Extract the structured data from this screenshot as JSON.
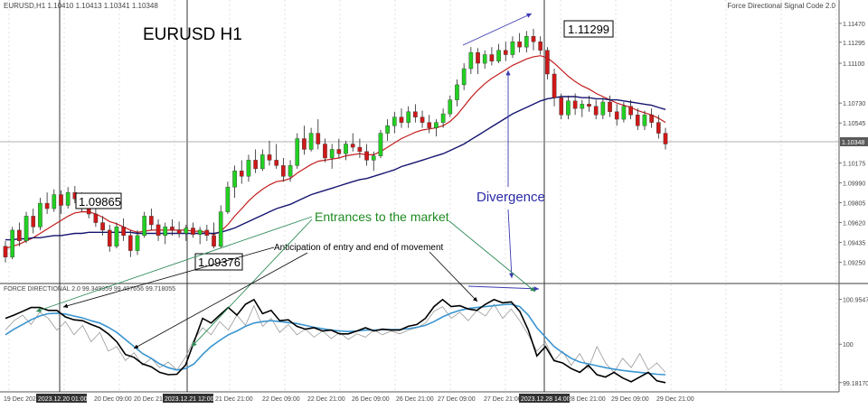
{
  "chart_data": [
    {
      "type": "candlestick",
      "header": "EURUSD,H1  1.10410 1.10413 1.10341 1.10348",
      "title": "EURUSD H1",
      "indicator_name": "Force Directional Signal Code 2.0",
      "current_price_label": "1.10348",
      "y_ticks": [
        "1.11470",
        "1.11295",
        "1.11100",
        "1.10730",
        "1.10545",
        "1.10175",
        "1.09990",
        "1.09805",
        "1.09620",
        "1.09435",
        "1.09250"
      ],
      "ylim": [
        1.0913,
        1.1157
      ],
      "candles": [
        [
          1.094,
          1.0945,
          1.0925,
          1.093
        ],
        [
          1.093,
          1.0958,
          1.0928,
          1.0955
        ],
        [
          1.0955,
          1.0962,
          1.094,
          1.0945
        ],
        [
          1.0945,
          1.0972,
          1.0943,
          1.0968
        ],
        [
          1.0968,
          1.0975,
          1.0952,
          1.0958
        ],
        [
          1.0958,
          1.0985,
          1.0955,
          1.098
        ],
        [
          1.098,
          1.099,
          1.097,
          1.0975
        ],
        [
          1.0975,
          1.0993,
          1.0972,
          1.0988
        ],
        [
          1.0988,
          1.0992,
          1.097,
          1.0978
        ],
        [
          1.0978,
          1.0995,
          1.0975,
          1.099
        ],
        [
          1.099,
          1.0996,
          1.098,
          1.0984
        ],
        [
          1.0984,
          1.099,
          1.0972,
          1.0976
        ],
        [
          1.0976,
          1.0982,
          1.0966,
          1.097
        ],
        [
          1.097,
          1.0975,
          1.0958,
          1.0962
        ],
        [
          1.0962,
          1.0968,
          1.095,
          1.0955
        ],
        [
          1.0955,
          1.096,
          1.0935,
          1.094
        ],
        [
          1.094,
          1.0962,
          1.0938,
          1.0958
        ],
        [
          1.0958,
          1.0966,
          1.0945,
          1.095
        ],
        [
          1.095,
          1.0955,
          1.093,
          1.0936
        ],
        [
          1.0936,
          1.0955,
          1.0932,
          1.095
        ],
        [
          1.095,
          1.0972,
          1.0948,
          1.0968
        ],
        [
          1.0968,
          1.0975,
          1.0955,
          1.096
        ],
        [
          1.096,
          1.0965,
          1.0945,
          1.095
        ],
        [
          1.095,
          1.0962,
          1.0942,
          1.0958
        ],
        [
          1.0958,
          1.0965,
          1.095,
          1.0955
        ],
        [
          1.0955,
          1.0963,
          1.0948,
          1.0952
        ],
        [
          1.0952,
          1.096,
          1.0945,
          1.0957
        ],
        [
          1.0957,
          1.0962,
          1.0948,
          1.0951
        ],
        [
          1.0951,
          1.0958,
          1.0942,
          1.0955
        ],
        [
          1.0955,
          1.096,
          1.0945,
          1.095
        ],
        [
          1.095,
          1.0962,
          1.0938,
          1.094
        ],
        [
          1.094,
          1.0978,
          1.0938,
          1.0972
        ],
        [
          1.0972,
          1.1,
          1.097,
          1.0995
        ],
        [
          1.0995,
          1.1015,
          1.0985,
          1.101
        ],
        [
          1.101,
          1.102,
          1.0998,
          1.1005
        ],
        [
          1.1005,
          1.1025,
          1.1,
          1.102
        ],
        [
          1.102,
          1.103,
          1.1008,
          1.1012
        ],
        [
          1.1012,
          1.103,
          1.101,
          1.1025
        ],
        [
          1.1025,
          1.1038,
          1.1015,
          1.102
        ],
        [
          1.102,
          1.1035,
          1.1012,
          1.1015
        ],
        [
          1.1015,
          1.1022,
          1.1,
          1.1005
        ],
        [
          1.1005,
          1.102,
          1.1,
          1.1015
        ],
        [
          1.1015,
          1.1045,
          1.1012,
          1.104
        ],
        [
          1.104,
          1.1052,
          1.1025,
          1.103
        ],
        [
          1.103,
          1.105,
          1.1028,
          1.1045
        ],
        [
          1.1045,
          1.1058,
          1.103,
          1.1035
        ],
        [
          1.1035,
          1.104,
          1.1018,
          1.1022
        ],
        [
          1.1022,
          1.1035,
          1.1012,
          1.103
        ],
        [
          1.103,
          1.104,
          1.1022,
          1.1026
        ],
        [
          1.1026,
          1.1038,
          1.102,
          1.1035
        ],
        [
          1.1035,
          1.1045,
          1.1028,
          1.1032
        ],
        [
          1.1032,
          1.104,
          1.1022,
          1.1028
        ],
        [
          1.1028,
          1.1035,
          1.1015,
          1.102
        ],
        [
          1.102,
          1.1028,
          1.101,
          1.1024
        ],
        [
          1.1024,
          1.1048,
          1.1022,
          1.1045
        ],
        [
          1.1045,
          1.1058,
          1.1038,
          1.1052
        ],
        [
          1.1052,
          1.1065,
          1.1045,
          1.106
        ],
        [
          1.106,
          1.1068,
          1.105,
          1.1055
        ],
        [
          1.1055,
          1.107,
          1.105,
          1.1065
        ],
        [
          1.1065,
          1.1072,
          1.1055,
          1.106
        ],
        [
          1.106,
          1.1066,
          1.105,
          1.1055
        ],
        [
          1.1055,
          1.1062,
          1.1045,
          1.105
        ],
        [
          1.105,
          1.1058,
          1.1042,
          1.1055
        ],
        [
          1.1055,
          1.1068,
          1.105,
          1.1063
        ],
        [
          1.1063,
          1.108,
          1.106,
          1.1076
        ],
        [
          1.1076,
          1.1095,
          1.107,
          1.109
        ],
        [
          1.109,
          1.111,
          1.1085,
          1.1105
        ],
        [
          1.1105,
          1.1125,
          1.11,
          1.112
        ],
        [
          1.112,
          1.1124,
          1.11,
          1.111
        ],
        [
          1.111,
          1.1122,
          1.1105,
          1.1118
        ],
        [
          1.1118,
          1.1125,
          1.1108,
          1.1112
        ],
        [
          1.1112,
          1.1128,
          1.111,
          1.1122
        ],
        [
          1.1122,
          1.113,
          1.1112,
          1.1118
        ],
        [
          1.1118,
          1.1135,
          1.1115,
          1.113
        ],
        [
          1.113,
          1.1138,
          1.112,
          1.1125
        ],
        [
          1.1125,
          1.114,
          1.112,
          1.1135
        ],
        [
          1.1135,
          1.1142,
          1.1122,
          1.113
        ],
        [
          1.113,
          1.1135,
          1.1118,
          1.1122
        ],
        [
          1.1122,
          1.1125,
          1.1095,
          1.11
        ],
        [
          1.11,
          1.1105,
          1.107,
          1.1078
        ],
        [
          1.1078,
          1.1082,
          1.1058,
          1.1062
        ],
        [
          1.1062,
          1.108,
          1.1058,
          1.1075
        ],
        [
          1.1075,
          1.1082,
          1.1062,
          1.1068
        ],
        [
          1.1068,
          1.1076,
          1.106,
          1.1072
        ],
        [
          1.1072,
          1.108,
          1.1065,
          1.107
        ],
        [
          1.107,
          1.1076,
          1.1058,
          1.1062
        ],
        [
          1.1062,
          1.1078,
          1.1058,
          1.1074
        ],
        [
          1.1074,
          1.108,
          1.106,
          1.1065
        ],
        [
          1.1065,
          1.1072,
          1.1052,
          1.1058
        ],
        [
          1.1058,
          1.1074,
          1.1055,
          1.107
        ],
        [
          1.107,
          1.1076,
          1.1058,
          1.1062
        ],
        [
          1.1062,
          1.1068,
          1.1048,
          1.1052
        ],
        [
          1.1052,
          1.1066,
          1.1048,
          1.1062
        ],
        [
          1.1062,
          1.1068,
          1.105,
          1.1055
        ],
        [
          1.1055,
          1.1062,
          1.104,
          1.1045
        ],
        [
          1.1045,
          1.105,
          1.103,
          1.1035
        ]
      ],
      "ma_red": [
        1.0938,
        1.094,
        1.0942,
        1.0945,
        1.0948,
        1.0952,
        1.0956,
        1.096,
        1.0964,
        1.0968,
        1.0971,
        1.0972,
        1.0972,
        1.097,
        1.0967,
        1.0963,
        1.0961,
        1.0958,
        1.0955,
        1.0953,
        1.0954,
        1.0955,
        1.0955,
        1.0955,
        1.0955,
        1.0955,
        1.0955,
        1.0954,
        1.0954,
        1.0953,
        1.0951,
        1.0954,
        1.096,
        1.0968,
        1.0975,
        1.0982,
        1.0988,
        1.0993,
        1.0997,
        1.1,
        1.1001,
        1.1003,
        1.1008,
        1.1012,
        1.1016,
        1.1019,
        1.102,
        1.1021,
        1.1022,
        1.1024,
        1.1025,
        1.1026,
        1.1025,
        1.1025,
        1.1028,
        1.1032,
        1.1036,
        1.104,
        1.1043,
        1.1046,
        1.1048,
        1.1049,
        1.105,
        1.1052,
        1.1056,
        1.1062,
        1.107,
        1.1078,
        1.1085,
        1.1091,
        1.1096,
        1.11,
        1.1104,
        1.1108,
        1.1111,
        1.1114,
        1.1116,
        1.1117,
        1.1115,
        1.111,
        1.1104,
        1.1098,
        1.1093,
        1.1089,
        1.1086,
        1.1082,
        1.1079,
        1.1076,
        1.1073,
        1.1071,
        1.1069,
        1.1066,
        1.1064,
        1.1062,
        1.1059,
        1.1055
      ],
      "ma_blue": [
        1.0946,
        1.0946,
        1.0947,
        1.0947,
        1.0948,
        1.0948,
        1.0949,
        1.095,
        1.095,
        1.0951,
        1.0952,
        1.0952,
        1.0953,
        1.0953,
        1.0953,
        1.0953,
        1.0953,
        1.0953,
        1.0953,
        1.0952,
        1.0952,
        1.0952,
        1.0952,
        1.0952,
        1.0952,
        1.0952,
        1.0952,
        1.0952,
        1.0952,
        1.0952,
        1.0952,
        1.0953,
        1.0955,
        1.0957,
        1.096,
        1.0963,
        1.0966,
        1.0969,
        1.0972,
        1.0975,
        1.0977,
        1.0979,
        1.0982,
        1.0985,
        1.0988,
        1.099,
        1.0992,
        1.0994,
        1.0996,
        1.0998,
        1.1,
        1.1002,
        1.1003,
        1.1005,
        1.1007,
        1.1009,
        1.1011,
        1.1014,
        1.1016,
        1.1018,
        1.102,
        1.1022,
        1.1024,
        1.1026,
        1.1029,
        1.1032,
        1.1035,
        1.1039,
        1.1043,
        1.1047,
        1.1051,
        1.1055,
        1.1059,
        1.1063,
        1.1066,
        1.1069,
        1.1072,
        1.1075,
        1.1077,
        1.1078,
        1.1079,
        1.1079,
        1.1079,
        1.1078,
        1.1078,
        1.1077,
        1.1077,
        1.1076,
        1.1076,
        1.1075,
        1.1074,
        1.1073,
        1.1072,
        1.1071,
        1.1069,
        1.1067
      ]
    },
    {
      "type": "line",
      "header": "FORCE DIRECTIONAL 2.0  99.349959 99.407656 99.718055",
      "y_ticks": [
        "100.95475",
        "100",
        "99.181708"
      ],
      "ylim": [
        99.1,
        101.1
      ],
      "x_labels": [
        "19 Dec 2023",
        "2023.12.20 01:00",
        "20 Dec 09:00",
        "20 Dec 21:0",
        "2023.12.21 12:00",
        "21 Dec 21:00",
        "22 Dec 09:00",
        "22 Dec 21:00",
        "26 Dec 09:00",
        "26 Dec 21:00",
        "27 Dec 09:00",
        "27 Dec 21:00",
        "2023.12.28 14:00",
        "28 Dec 21:00",
        "29 Dec 09:00",
        "29 Dec 21:00"
      ],
      "series": [
        {
          "name": "",
          "values": [
            100.55,
            100.62,
            100.7,
            100.78,
            100.78,
            100.72,
            100.72,
            100.58,
            100.52,
            100.5,
            100.42,
            100.35,
            100.22,
            100.05,
            99.78,
            99.72,
            99.58,
            99.52,
            99.4,
            99.35,
            99.36,
            99.55,
            100.05,
            100.55,
            100.45,
            100.62,
            100.78,
            100.62,
            100.85,
            100.95,
            100.65,
            100.72,
            100.5,
            100.52,
            100.38,
            100.32,
            100.35,
            100.28,
            100.3,
            100.22,
            100.22,
            100.28,
            100.35,
            100.28,
            100.32,
            100.3,
            100.3,
            100.38,
            100.42,
            100.55,
            100.8,
            100.95,
            100.8,
            100.82,
            100.75,
            100.72,
            100.85,
            100.95,
            100.88,
            100.9,
            100.7,
            100.3,
            99.75,
            99.95,
            99.65,
            99.6,
            99.48,
            99.4,
            99.55,
            99.35,
            99.3,
            99.4,
            99.28,
            99.2,
            99.3,
            99.4,
            99.22,
            99.18
          ]
        },
        {
          "name": "",
          "values": [
            100.2,
            100.32,
            100.42,
            100.52,
            100.6,
            100.65,
            100.66,
            100.64,
            100.6,
            100.56,
            100.5,
            100.45,
            100.36,
            100.25,
            100.1,
            99.95,
            99.8,
            99.7,
            99.58,
            99.5,
            99.45,
            99.48,
            99.58,
            99.78,
            99.95,
            100.08,
            100.2,
            100.28,
            100.38,
            100.45,
            100.48,
            100.5,
            100.48,
            100.46,
            100.44,
            100.4,
            100.36,
            100.33,
            100.3,
            100.28,
            100.27,
            100.28,
            100.3,
            100.3,
            100.31,
            100.31,
            100.31,
            100.33,
            100.36,
            100.4,
            100.48,
            100.58,
            100.66,
            100.72,
            100.76,
            100.78,
            100.8,
            100.82,
            100.84,
            100.85,
            100.8,
            100.62,
            100.35,
            100.15,
            99.95,
            99.82,
            99.7,
            99.62,
            99.58,
            99.54,
            99.5,
            99.47,
            99.44,
            99.42,
            99.4,
            99.38,
            99.36,
            99.35
          ]
        },
        {
          "name": "",
          "values": [
            100.3,
            100.5,
            100.62,
            100.42,
            100.68,
            100.55,
            100.3,
            100.48,
            100.2,
            100.4,
            100.05,
            100.25,
            99.85,
            99.95,
            99.65,
            99.82,
            99.55,
            99.7,
            99.5,
            99.62,
            99.45,
            99.72,
            100.1,
            100.35,
            100.2,
            100.48,
            100.3,
            100.62,
            100.4,
            100.82,
            100.38,
            100.55,
            100.25,
            100.42,
            100.2,
            100.32,
            100.15,
            100.28,
            100.12,
            100.25,
            100.1,
            100.22,
            100.15,
            100.3,
            100.2,
            100.28,
            100.22,
            100.3,
            100.35,
            100.45,
            100.7,
            100.8,
            100.55,
            100.68,
            100.5,
            100.72,
            100.6,
            100.85,
            100.55,
            100.75,
            100.5,
            100.2,
            99.85,
            100.05,
            99.65,
            99.85,
            99.55,
            99.8,
            99.48,
            99.95,
            99.6,
            99.4,
            99.7,
            99.5,
            99.8,
            99.45,
            99.6,
            99.4
          ]
        }
      ]
    }
  ],
  "annotations": {
    "high_price": "1.11299",
    "left_high_price": "1.09865",
    "low_price": "1.09376",
    "divergence": "Divergence",
    "entrances": "Entrances to the market",
    "anticipation": "Anticipation of entry and end of movement"
  }
}
